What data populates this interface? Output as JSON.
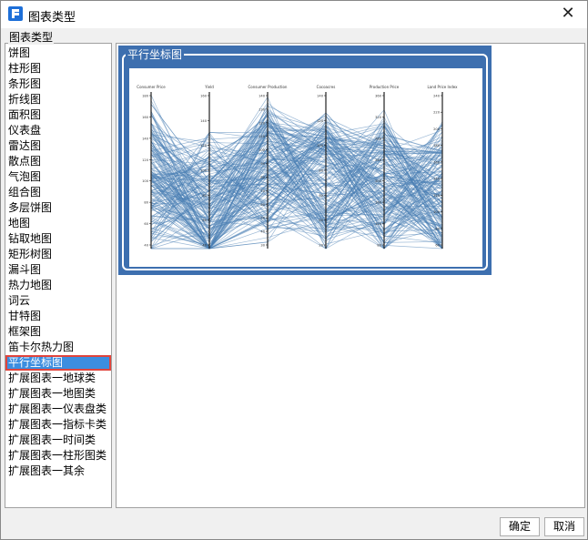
{
  "window": {
    "title": "图表类型",
    "close_label": "✕"
  },
  "group_label": "图表类型",
  "chart_types": [
    "饼图",
    "柱形图",
    "条形图",
    "折线图",
    "面积图",
    "仪表盘",
    "雷达图",
    "散点图",
    "气泡图",
    "组合图",
    "多层饼图",
    "地图",
    "钻取地图",
    "矩形树图",
    "漏斗图",
    "热力地图",
    "词云",
    "甘特图",
    "框架图",
    "笛卡尔热力图",
    "平行坐标图",
    "扩展图表一地球类",
    "扩展图表一地图类",
    "扩展图表一仪表盘类",
    "扩展图表一指标卡类",
    "扩展图表一时间类",
    "扩展图表一柱形图类",
    "扩展图表一其余"
  ],
  "selected_index": 20,
  "preview": {
    "title": "平行坐标图",
    "axes": [
      {
        "name": "Consumer Price",
        "ticks": [
          "180",
          "160",
          "140",
          "120",
          "100",
          "80",
          "60",
          "40"
        ]
      },
      {
        "name": "Yield",
        "ticks": [
          "160",
          "140",
          "120",
          "100",
          "80",
          "60",
          "40"
        ]
      },
      {
        "name": "Consumer Production",
        "ticks": [
          "140",
          "130",
          "120",
          "110",
          "100",
          "90",
          "80",
          "70",
          "60",
          "50",
          "40",
          "30"
        ]
      },
      {
        "name": "Cocoacres",
        "ticks": [
          "140",
          "120",
          "100",
          "80",
          "60",
          "40",
          "20"
        ]
      },
      {
        "name": "Production Price",
        "ticks": [
          "360",
          "320",
          "280",
          "240",
          "200",
          "160",
          "120",
          "80"
        ]
      },
      {
        "name": "Land Price Index",
        "ticks": [
          "240",
          "220",
          "200",
          "180",
          "160",
          "140",
          "120",
          "100",
          "80",
          "60"
        ]
      }
    ],
    "line_color": "#4a7fb5",
    "frame_color": "#3d6faf"
  },
  "buttons": {
    "ok": "确定",
    "cancel": "取消"
  }
}
